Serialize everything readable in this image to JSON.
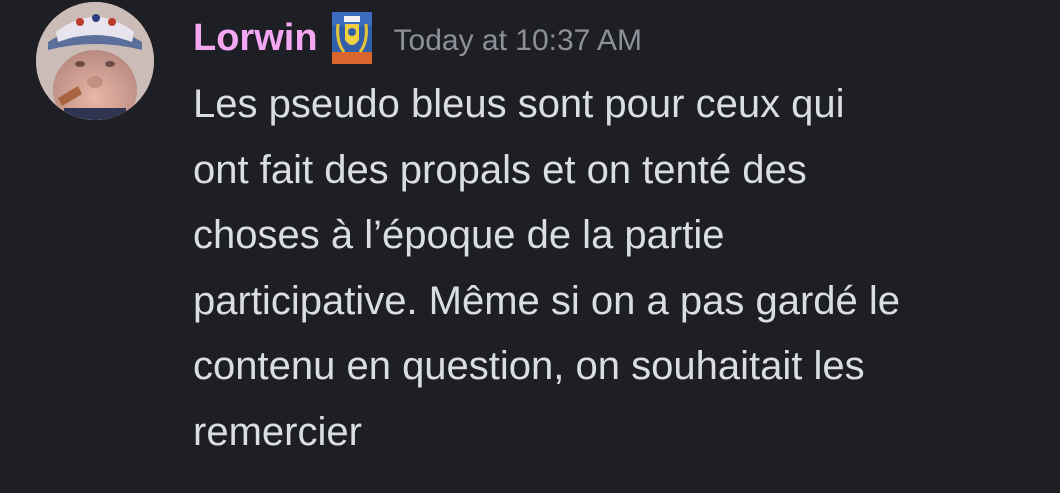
{
  "message": {
    "author": {
      "username": "Lorwin",
      "avatar_icon": "user-avatar-photo",
      "role_badge_icon": "guild-shield-badge-icon",
      "username_color": "#f3a7f2"
    },
    "timestamp": "Today at 10:37 AM",
    "content_lines": [
      "Les pseudo bleus sont pour ceux qui",
      "ont fait des propals et on tenté des",
      "choses à l’époque de la partie",
      "participative. Même si on a pas gardé le",
      "contenu en question, on souhaitait les",
      "remercier"
    ]
  },
  "theme": {
    "background": "#1e1f24",
    "text": "#dbdee1",
    "muted": "#8d9099"
  }
}
